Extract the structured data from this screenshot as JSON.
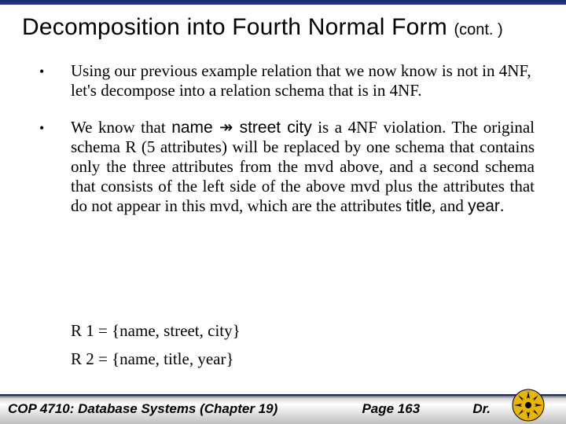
{
  "title": {
    "main": "Decomposition into Fourth Normal Form ",
    "cont": "(cont. )"
  },
  "bullets": [
    {
      "text": "Using our previous example relation that we now know is not in 4NF, let's decompose into a relation schema that is in 4NF."
    },
    {
      "pre": "We know that ",
      "mvd_lhs": "name",
      "mvd_arrow": " ↠ ",
      "mvd_rhs": "street city",
      "post1": " is a 4NF violation. The original schema R (5 attributes) will be replaced by one schema that contains only the three attributes from the mvd above, and a second schema that consists of the left side of the above mvd plus the attributes that do not appear in this mvd, which are the attributes ",
      "attr1": "title",
      "post2": ", and ",
      "attr2": "year",
      "post3": "."
    }
  ],
  "results": {
    "r1": "R 1 = {name, street, city}",
    "r2": "R 2 = {name, title, year}"
  },
  "footer": {
    "left": "COP 4710: Database Systems  (Chapter 19)",
    "mid": "Page 163",
    "right": "Dr."
  }
}
